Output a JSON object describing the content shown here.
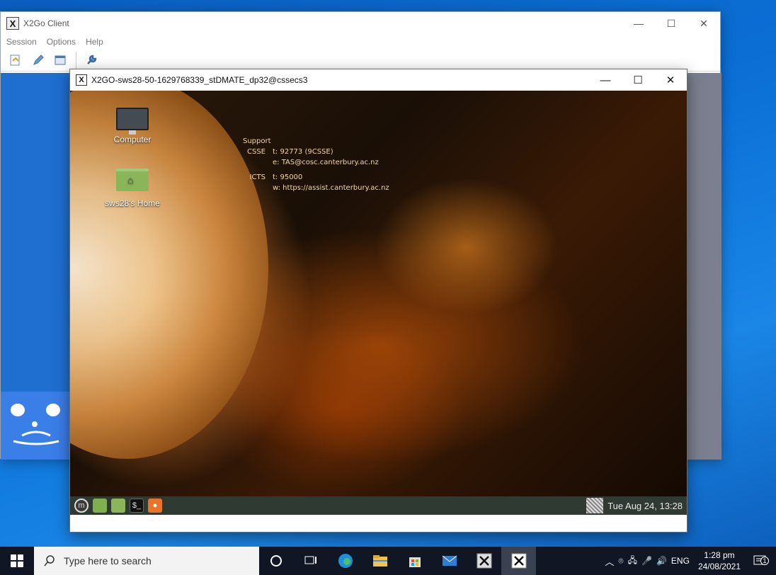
{
  "client": {
    "title": "X2Go Client",
    "menu": [
      "Session",
      "Options",
      "Help"
    ],
    "controls": {
      "minimize": "—",
      "maximize": "☐",
      "close": "✕"
    }
  },
  "session": {
    "title": "X2GO-sws28-50-1629768339_stDMATE_dp32@cssecs3",
    "controls": {
      "minimize": "—",
      "maximize": "☐",
      "close": "✕"
    }
  },
  "desktop": {
    "icons": [
      {
        "label": "Computer"
      },
      {
        "label": "sws28's Home"
      }
    ],
    "support": {
      "heading": "Support",
      "csse_label": "CSSE",
      "csse_phone": "t: 92773 (9CSSE)",
      "csse_email": "e: TAS@cosc.canterbury.ac.nz",
      "icts_label": "ICTS",
      "icts_phone": "t: 95000",
      "icts_web": "w: https://assist.canterbury.ac.nz"
    },
    "panel_clock": "Tue Aug 24, 13:28"
  },
  "taskbar": {
    "search_placeholder": "Type here to search",
    "language": "ENG",
    "time": "1:28 pm",
    "date": "24/08/2021",
    "notification_count": "1"
  }
}
